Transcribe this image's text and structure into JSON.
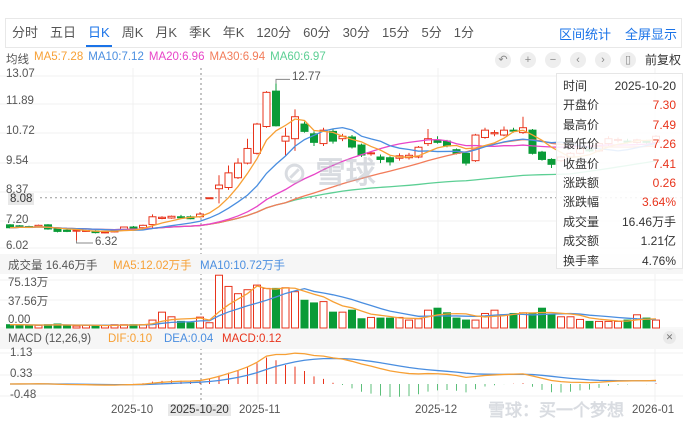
{
  "toolbar": {
    "tabs": [
      "分时",
      "五日",
      "日K",
      "周K",
      "月K",
      "季K",
      "年K",
      "120分",
      "60分",
      "30分",
      "15分",
      "5分",
      "1分"
    ],
    "active": "日K",
    "range_stats": "区间统计",
    "fullscreen": "全屏显示"
  },
  "ma_legend": {
    "title": "均线",
    "ma5": "MA5:7.28",
    "ma10": "MA10:7.12",
    "ma20": "MA20:6.96",
    "ma30": "MA30:6.94",
    "ma60": "MA60:6.97"
  },
  "controls": {
    "icons": [
      "reset-icon",
      "zoom-in-icon",
      "zoom-out-icon",
      "prev-icon",
      "next-icon",
      "candle-icon"
    ],
    "glyphs": [
      "↶",
      "+",
      "−",
      "‹",
      "›",
      "▯"
    ],
    "adjust": "前复权"
  },
  "price_axis": [
    "13.07",
    "11.89",
    "10.72",
    "9.54",
    "8.37",
    "7.20",
    "6.02"
  ],
  "crosshair_price": "8.08",
  "max_label": "12.77",
  "min_label": "6.32",
  "info_panel": [
    {
      "k": "时间",
      "v": "2025-10-20",
      "red": false
    },
    {
      "k": "开盘价",
      "v": "7.30",
      "red": true
    },
    {
      "k": "最高价",
      "v": "7.49",
      "red": true
    },
    {
      "k": "最低价",
      "v": "7.26",
      "red": true
    },
    {
      "k": "收盘价",
      "v": "7.41",
      "red": true
    },
    {
      "k": "涨跌额",
      "v": "0.26",
      "red": true
    },
    {
      "k": "涨跌幅",
      "v": "3.64%",
      "red": true
    },
    {
      "k": "成交量",
      "v": "16.46万手",
      "red": false
    },
    {
      "k": "成交额",
      "v": "1.21亿",
      "red": false
    },
    {
      "k": "换手率",
      "v": "4.76%",
      "red": false
    }
  ],
  "volume": {
    "title": "成交量 16.46万手",
    "ma5": "MA5:12.02万手",
    "ma10": "MA10:10.72万手",
    "axis": [
      "75.13万",
      "37.56万",
      "0.00"
    ]
  },
  "macd": {
    "title": "MACD (12,26,9)",
    "dif": "DIF:0.10",
    "dea": "DEA:0.04",
    "macd": "MACD:0.12",
    "axis": [
      "1.13",
      "0.33",
      "-0.48"
    ]
  },
  "x_axis": [
    "2025-10",
    "2025-10-20",
    "2025-11",
    "2025-12",
    "2026-01"
  ],
  "watermark": "雪球：买一个梦想",
  "colors": {
    "up": "#e8341c",
    "down": "#0a9b37",
    "ma5": "#f7a035",
    "ma10": "#4a8ee0",
    "ma20": "#e845c8",
    "ma30": "#f27c5a",
    "ma60": "#5ccf94",
    "accent": "#1a73e8"
  },
  "chart_data": {
    "type": "candlestick",
    "ohlc": [
      [
        6.97,
        7.0,
        6.82,
        6.85
      ],
      [
        6.93,
        6.96,
        6.85,
        6.88
      ],
      [
        6.9,
        6.93,
        6.84,
        6.87
      ],
      [
        6.9,
        6.98,
        6.87,
        6.95
      ],
      [
        6.97,
        7.0,
        6.77,
        6.8
      ],
      [
        6.8,
        6.83,
        6.66,
        6.7
      ],
      [
        6.75,
        6.78,
        6.67,
        6.7
      ],
      [
        6.72,
        6.78,
        6.32,
        6.75
      ],
      [
        6.72,
        6.77,
        6.68,
        6.74
      ],
      [
        6.72,
        6.75,
        6.62,
        6.65
      ],
      [
        6.66,
        6.7,
        6.62,
        6.68
      ],
      [
        6.7,
        6.75,
        6.66,
        6.72
      ],
      [
        6.75,
        6.9,
        6.72,
        6.88
      ],
      [
        6.88,
        6.92,
        6.8,
        6.82
      ],
      [
        6.85,
        6.98,
        6.82,
        6.95
      ],
      [
        6.98,
        7.4,
        6.8,
        7.3
      ],
      [
        7.23,
        7.32,
        7.2,
        7.28
      ],
      [
        7.25,
        7.35,
        7.22,
        7.32
      ],
      [
        7.3,
        7.38,
        7.24,
        7.27
      ],
      [
        7.3,
        7.35,
        7.2,
        7.22
      ],
      [
        7.3,
        7.49,
        7.26,
        7.41
      ],
      [
        8.05,
        8.08,
        8.05,
        8.08
      ],
      [
        8.45,
        9.0,
        7.85,
        8.6
      ],
      [
        8.5,
        9.4,
        8.4,
        9.1
      ],
      [
        8.9,
        9.7,
        8.85,
        9.5
      ],
      [
        9.5,
        10.5,
        9.45,
        10.1
      ],
      [
        9.9,
        11.15,
        9.85,
        11.1
      ],
      [
        11.0,
        12.45,
        10.95,
        12.4
      ],
      [
        12.45,
        12.77,
        11.0,
        11.03
      ],
      [
        10.4,
        10.95,
        9.8,
        10.6
      ],
      [
        10.5,
        11.7,
        10.0,
        11.4
      ],
      [
        11.1,
        11.2,
        10.75,
        10.8
      ],
      [
        10.7,
        10.8,
        10.2,
        10.35
      ],
      [
        10.3,
        10.95,
        10.2,
        10.85
      ],
      [
        10.8,
        10.9,
        10.3,
        10.4
      ],
      [
        10.5,
        10.7,
        10.4,
        10.6
      ],
      [
        10.57,
        10.65,
        10.1,
        10.16
      ],
      [
        10.24,
        10.3,
        9.75,
        9.83
      ],
      [
        9.88,
        9.98,
        9.8,
        9.92
      ],
      [
        9.75,
        9.85,
        9.5,
        9.65
      ],
      [
        9.72,
        9.78,
        9.4,
        9.55
      ],
      [
        9.7,
        9.9,
        9.6,
        9.8
      ],
      [
        9.72,
        9.92,
        9.65,
        9.82
      ],
      [
        9.75,
        10.2,
        9.7,
        10.15
      ],
      [
        10.3,
        10.9,
        10.2,
        10.5
      ],
      [
        10.45,
        10.6,
        10.3,
        10.35
      ],
      [
        10.4,
        10.45,
        10.15,
        10.2
      ],
      [
        10.05,
        10.1,
        9.85,
        9.9
      ],
      [
        9.9,
        9.95,
        9.4,
        9.5
      ],
      [
        9.6,
        10.7,
        9.55,
        10.65
      ],
      [
        10.55,
        10.95,
        10.5,
        10.85
      ],
      [
        10.7,
        10.85,
        10.6,
        10.75
      ],
      [
        10.65,
        11.0,
        10.6,
        10.85
      ],
      [
        10.85,
        10.95,
        10.75,
        10.82
      ],
      [
        10.75,
        11.4,
        10.7,
        10.95
      ],
      [
        10.85,
        10.9,
        9.85,
        9.9
      ],
      [
        9.95,
        10.0,
        9.6,
        9.65
      ],
      [
        9.65,
        9.7,
        9.3,
        9.45
      ],
      [
        9.6,
        9.8,
        9.55,
        9.75
      ],
      [
        9.75,
        9.95,
        9.7,
        9.9
      ],
      [
        9.9,
        10.15,
        9.85,
        10.1
      ],
      [
        10.05,
        10.1,
        9.95,
        10.0
      ],
      [
        10.0,
        10.35,
        9.95,
        10.3
      ],
      [
        10.3,
        10.6,
        10.2,
        10.5
      ],
      [
        10.45,
        10.55,
        10.35,
        10.47
      ],
      [
        10.4,
        10.5,
        10.3,
        10.38
      ],
      [
        10.35,
        10.5,
        10.3,
        10.45
      ],
      [
        10.4,
        10.45,
        10.3,
        10.35
      ],
      [
        10.35,
        10.65,
        10.3,
        10.6
      ]
    ],
    "volume_wan": [
      5,
      5,
      4,
      4,
      5,
      6,
      4,
      3,
      4,
      4,
      4,
      5,
      5,
      5,
      5,
      12,
      24,
      17,
      10,
      8,
      16.46,
      8,
      80,
      63,
      52,
      58,
      65,
      60,
      60,
      61,
      55,
      42,
      38,
      40,
      24,
      24,
      27,
      14,
      16,
      15,
      15,
      16,
      12,
      14,
      27,
      30,
      23,
      15,
      12,
      12,
      22,
      27,
      20,
      22,
      23,
      22,
      30,
      20,
      17,
      17,
      13,
      10,
      10,
      10,
      10,
      12,
      20,
      15,
      12
    ],
    "price_range": [
      6.02,
      13.07
    ],
    "volume_range": [
      0,
      75.13
    ],
    "macd_range": [
      -0.48,
      1.13
    ]
  }
}
